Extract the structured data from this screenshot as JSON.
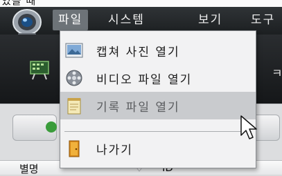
{
  "top_caption": "있을 때",
  "menubar": {
    "items": [
      {
        "label": "파일",
        "active": true
      },
      {
        "label": "시스템"
      },
      {
        "label": "보기"
      },
      {
        "label": "도구"
      }
    ]
  },
  "toolbar": {
    "partial_text_right": "ㅋ"
  },
  "dropdown": {
    "items": [
      {
        "label": "캡쳐 사진 열기",
        "icon": "picture-icon"
      },
      {
        "label": "비디오 파일 열기",
        "icon": "film-reel-icon"
      },
      {
        "label": "기록 파일 열기",
        "icon": "notepad-icon",
        "hovered": true
      },
      {
        "label": "나가기",
        "icon": "exit-door-icon"
      }
    ]
  },
  "grid": {
    "col_a": "별명",
    "col_b": "ID"
  },
  "colors": {
    "menubar_bg": "#2f3336",
    "menu_active_bg": "#6d7378",
    "dropdown_bg": "#f2f2f3",
    "hover_bg": "#c9cbce",
    "green_accent": "#3a9c3b"
  }
}
